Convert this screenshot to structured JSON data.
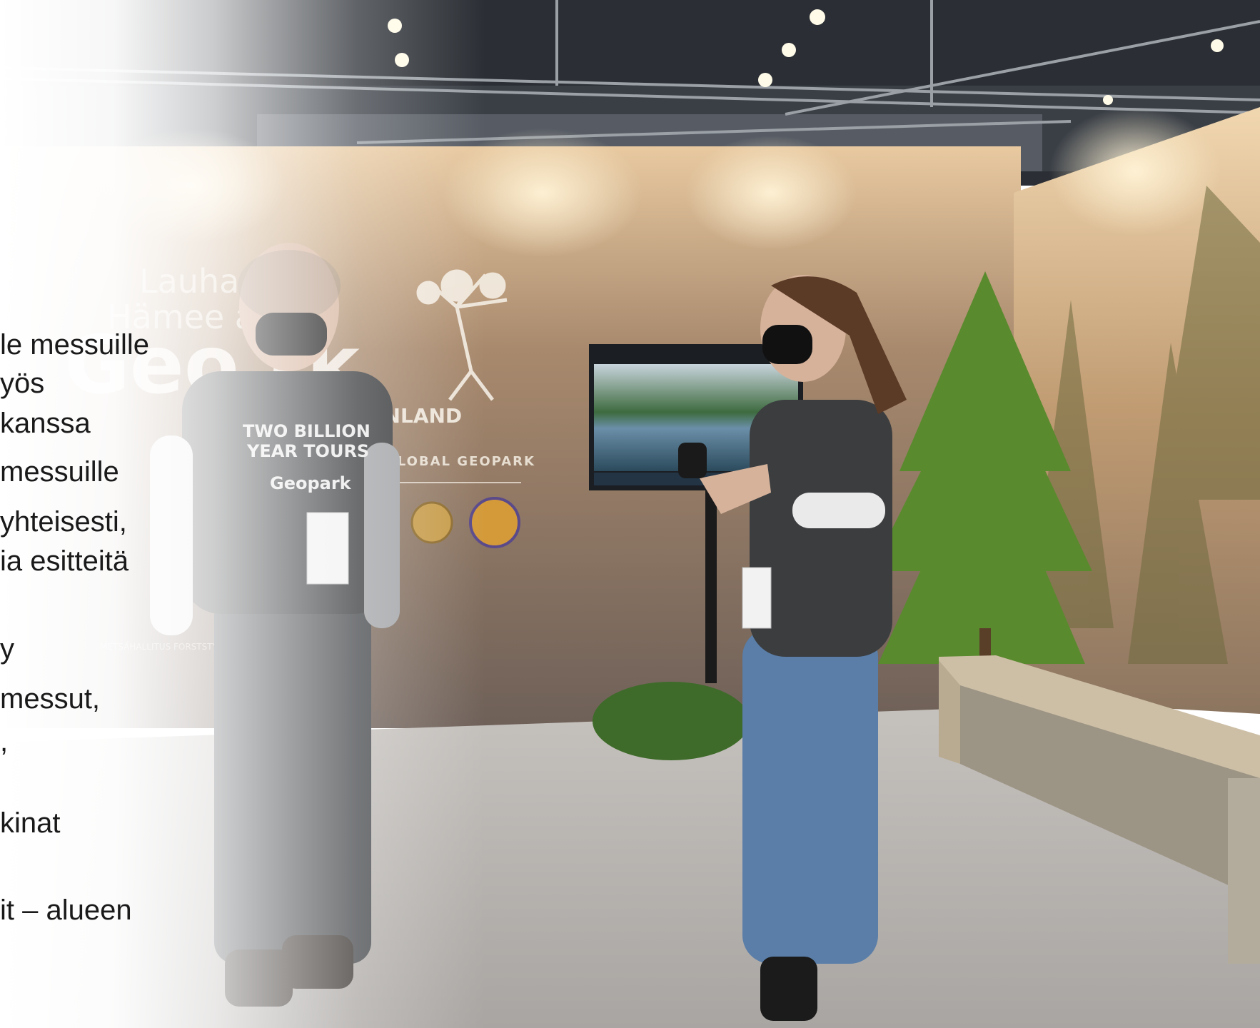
{
  "slide_lines": [
    "le messuille",
    "yös",
    "kanssa",
    "messuille",
    "yhteisesti,",
    "ia esitteitä",
    "y",
    "messut,",
    ",",
    "kinat",
    "it – alueen"
  ],
  "booth": {
    "title_line1": "Lauha ri -",
    "title_line2": "Hämee as",
    "geopark_word": "Geo rk",
    "country": "FINLAND",
    "global_label": "GLOBAL GEOPARK",
    "sponsor": "METSÄHALLITUS FORSTSTYRELSEN"
  },
  "shirt": {
    "brand_top": "TWO BILLION",
    "brand_bottom": "YEAR TOURS",
    "geopark": "Geopark"
  },
  "colors": {
    "wall": "#a7866a",
    "sky": "#d9b58a",
    "floor": "#bdb8b3",
    "ceiling": "#2b2f35",
    "tshirt": "#3b3d3f",
    "jeans": "#5a7ea8"
  }
}
